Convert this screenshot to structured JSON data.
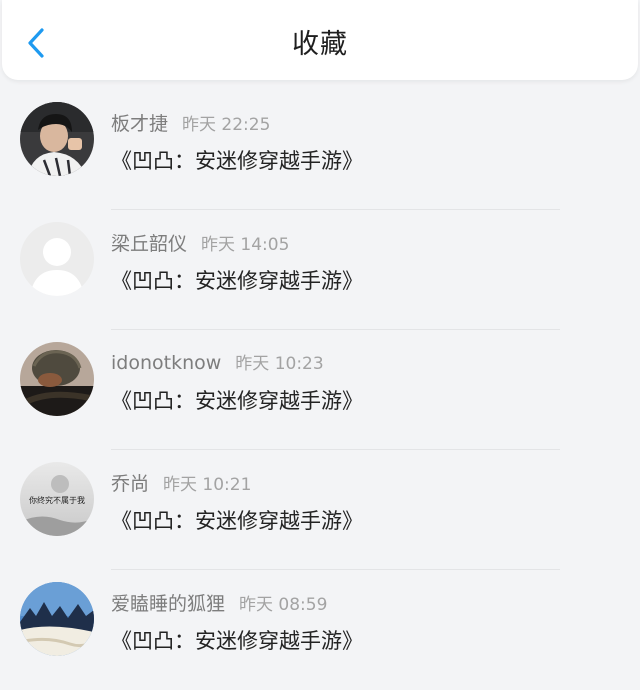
{
  "header": {
    "title": "收藏",
    "back_icon": "chevron-left-icon",
    "accent_color": "#1e9af0"
  },
  "items": [
    {
      "name": "板才捷",
      "time": "昨天 22:25",
      "content": "《凹凸：安迷修穿越手游》"
    },
    {
      "name": "梁丘韶仪",
      "time": "昨天 14:05",
      "content": "《凹凸：安迷修穿越手游》"
    },
    {
      "name": "idonotknow",
      "time": "昨天 10:23",
      "content": "《凹凸：安迷修穿越手游》"
    },
    {
      "name": "乔尚",
      "time": "昨天 10:21",
      "content": "《凹凸：安迷修穿越手游》",
      "avatar_text": "你终究不属于我"
    },
    {
      "name": "爱瞌睡的狐狸",
      "time": "昨天 08:59",
      "content": "《凹凸：安迷修穿越手游》"
    }
  ]
}
